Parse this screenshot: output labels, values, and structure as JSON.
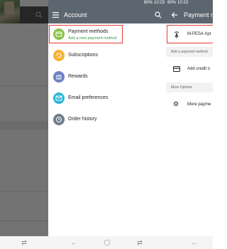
{
  "statusbar": {
    "battery": "80%",
    "time": "10:23"
  },
  "account": {
    "title": "Account",
    "items": [
      {
        "label": "Payment methods",
        "sublabel": "Add a new payment method",
        "icon": "credit-card-icon",
        "color": "#8bc34a"
      },
      {
        "label": "Subscriptions",
        "icon": "subscriptions-icon",
        "color": "#f9b233"
      },
      {
        "label": "Rewards",
        "icon": "rewards-icon",
        "color": "#6f80c5"
      },
      {
        "label": "Email preferences",
        "icon": "email-icon",
        "color": "#29b6d6"
      },
      {
        "label": "Order history",
        "icon": "history-icon",
        "color": "#6f7e8a"
      }
    ]
  },
  "payment": {
    "title": "Payment m",
    "mpesa": "M-PESA Xpr",
    "add_header": "Add a payment method",
    "add_credit": "Add credit o",
    "more_header": "More Options",
    "more_payment": "More payme"
  },
  "colors": {
    "appbar": "#5c6670",
    "highlight": "#e53935",
    "accent_green": "#2e9e3e"
  }
}
